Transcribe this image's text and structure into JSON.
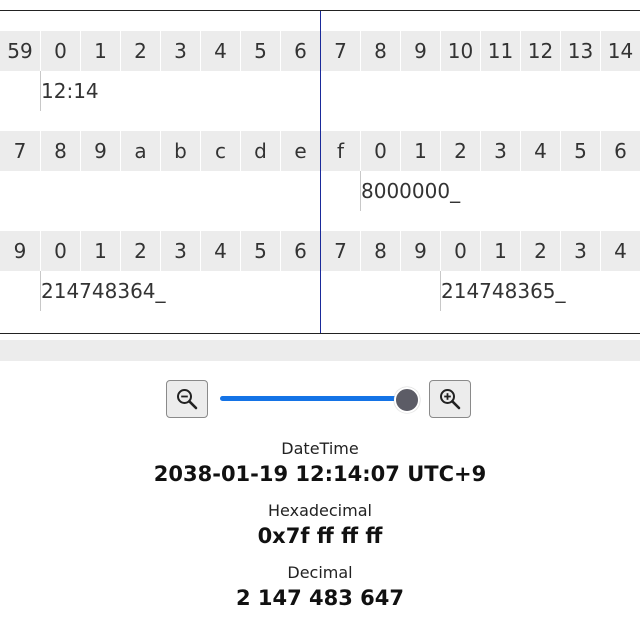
{
  "timeline": {
    "rows": [
      {
        "cells": [
          "59",
          "0",
          "1",
          "2",
          "3",
          "4",
          "5",
          "6",
          "7",
          "8",
          "9",
          "10",
          "11",
          "12",
          "13",
          "14"
        ],
        "marks": [
          {
            "label": "12:14",
            "cell_index": 1
          }
        ]
      },
      {
        "cells": [
          "7",
          "8",
          "9",
          "a",
          "b",
          "c",
          "d",
          "e",
          "f",
          "0",
          "1",
          "2",
          "3",
          "4",
          "5",
          "6"
        ],
        "marks": [
          {
            "label": "8000000_",
            "cell_index": 9
          }
        ]
      },
      {
        "cells": [
          "9",
          "0",
          "1",
          "2",
          "3",
          "4",
          "5",
          "6",
          "7",
          "8",
          "9",
          "0",
          "1",
          "2",
          "3",
          "4"
        ],
        "marks": [
          {
            "label": "214748364_",
            "cell_index": 1
          },
          {
            "label": "214748365_",
            "cell_index": 11
          }
        ]
      }
    ]
  },
  "zoom": {
    "out_icon": "zoom-out-icon",
    "in_icon": "zoom-in-icon",
    "level": 1.0,
    "accent_color": "#1473e6"
  },
  "info": {
    "datetime_label": "DateTime",
    "datetime_value": "2038-01-19 12:14:07 UTC+9",
    "hex_label": "Hexadecimal",
    "hex_value": "0x7f ff ff ff",
    "decimal_label": "Decimal",
    "decimal_value": "2 147 483 647"
  }
}
